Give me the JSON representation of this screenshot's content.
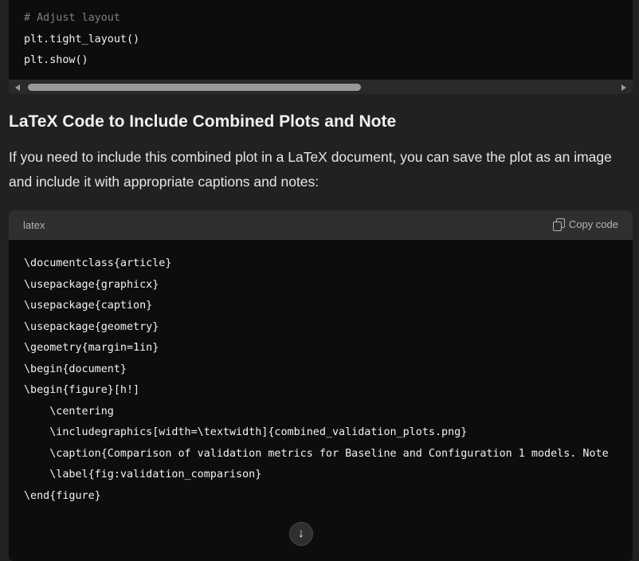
{
  "top_code": {
    "lines": [
      "# Adjust layout",
      "plt.tight_layout()",
      "plt.show()"
    ]
  },
  "section": {
    "heading": "LaTeX Code to Include Combined Plots and Note",
    "paragraph": "If you need to include this combined plot in a LaTeX document, you can save the plot as an image and include it with appropriate captions and notes:"
  },
  "code_block": {
    "language": "latex",
    "copy_label": "Copy code",
    "lines": [
      "\\documentclass{article}",
      "\\usepackage{graphicx}",
      "\\usepackage{caption}",
      "\\usepackage{geometry}",
      "\\geometry{margin=1in}",
      "",
      "\\begin{document}",
      "",
      "\\begin{figure}[h!]",
      "    \\centering",
      "    \\includegraphics[width=\\textwidth]{combined_validation_plots.png}",
      "    \\caption{Comparison of validation metrics for Baseline and Configuration 1 models. Note",
      "    \\label{fig:validation_comparison}",
      "\\end{figure}"
    ]
  },
  "scroll_down_icon": "arrow-down-icon"
}
